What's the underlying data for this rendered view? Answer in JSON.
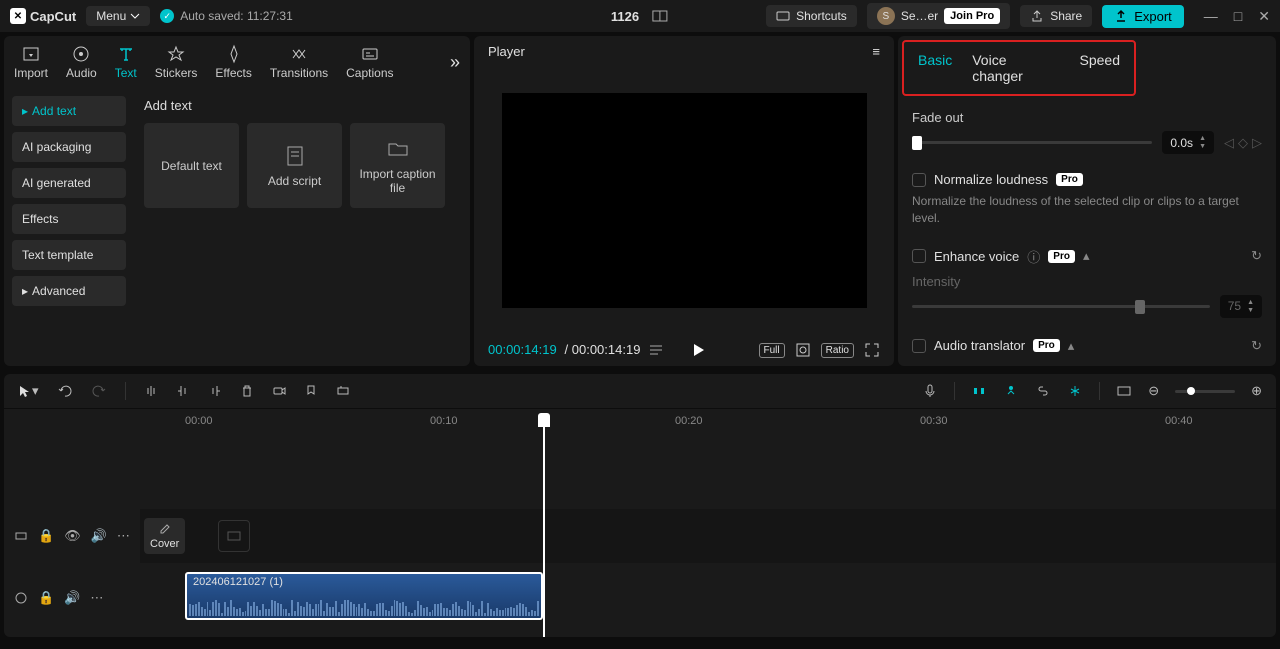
{
  "topbar": {
    "app_name": "CapCut",
    "menu_label": "Menu",
    "autosave_label": "Auto saved: 11:27:31",
    "center_number": "1126",
    "shortcuts_label": "Shortcuts",
    "user_label": "Se…er",
    "join_pro_label": "Join Pro",
    "share_label": "Share",
    "export_label": "Export"
  },
  "tabs": {
    "import": "Import",
    "audio": "Audio",
    "text": "Text",
    "stickers": "Stickers",
    "effects": "Effects",
    "transitions": "Transitions",
    "captions": "Captions"
  },
  "sidebar": {
    "add_text": "Add text",
    "ai_packaging": "AI packaging",
    "ai_generated": "AI generated",
    "effects": "Effects",
    "text_template": "Text template",
    "advanced": "Advanced"
  },
  "content": {
    "title": "Add text",
    "default_text": "Default text",
    "add_script": "Add script",
    "import_caption": "Import caption file"
  },
  "player": {
    "title": "Player",
    "current_time": "00:00:14:19",
    "total_time": "00:00:14:19",
    "full": "Full",
    "ratio": "Ratio"
  },
  "right": {
    "tabs": {
      "basic": "Basic",
      "voice_changer": "Voice changer",
      "speed": "Speed"
    },
    "fade_out": "Fade out",
    "fade_out_value": "0.0s",
    "normalize": "Normalize loudness",
    "pro": "Pro",
    "normalize_desc": "Normalize the loudness of the selected clip or clips to a target level.",
    "enhance_voice": "Enhance voice",
    "intensity": "Intensity",
    "intensity_value": "75",
    "audio_translator": "Audio translator"
  },
  "timeline": {
    "marks": [
      "00:00",
      "00:10",
      "00:20",
      "00:30",
      "00:40"
    ],
    "cover": "Cover",
    "clip_name": "202406121027 (1)"
  }
}
